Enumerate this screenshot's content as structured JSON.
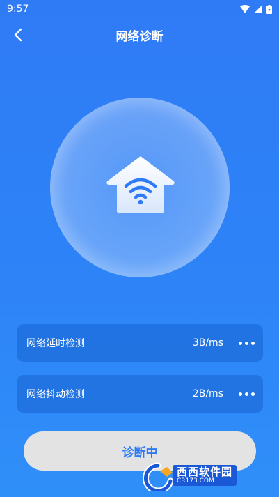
{
  "status_bar": {
    "time": "9:57"
  },
  "header": {
    "title": "网络诊断"
  },
  "rows": [
    {
      "label": "网络延时检测",
      "value": "3B/ms"
    },
    {
      "label": "网络抖动检测",
      "value": "2B/ms"
    }
  ],
  "action": {
    "label": "诊断中"
  },
  "watermark": {
    "brand": "西西软件园",
    "site": "CR173.COM"
  },
  "colors": {
    "background": "#2F7BF6",
    "accent": "#2F7BF6",
    "button_bg": "#E3E3E3"
  }
}
